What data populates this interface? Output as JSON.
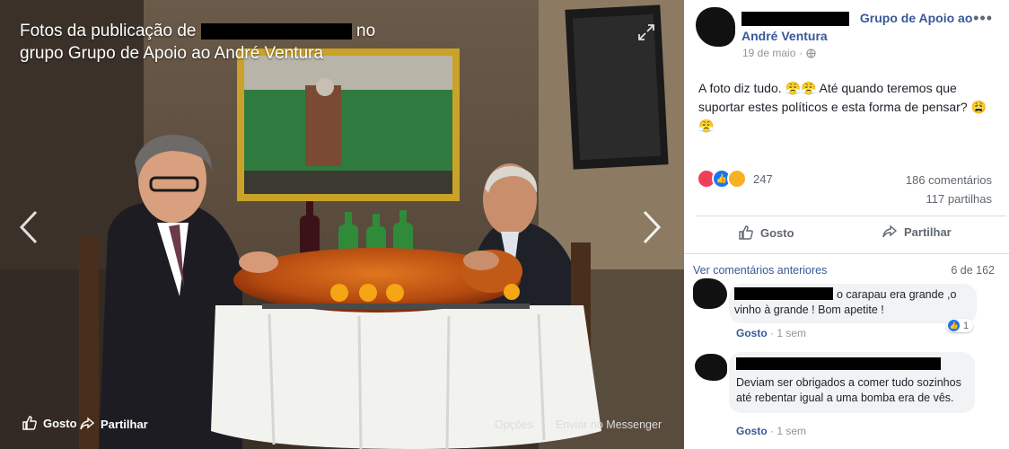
{
  "viewer": {
    "caption_line1_prefix": "Fotos da publicação de",
    "caption_line1_suffix": "no",
    "caption_line2": "grupo Grupo de Apoio ao André Ventura",
    "like_label": "Gosto",
    "share_label": "Partilhar",
    "options_label": "Opções",
    "messenger_label": "Enviar no Messenger"
  },
  "post": {
    "group_name": "Grupo de Apoio ao André Ventura",
    "date": "19 de maio",
    "text": "A foto diz tudo. 😤😤 Até quando teremos que suportar estes políticos e esta forma de pensar? 😩😤",
    "reaction_count": "247",
    "comments_count": "186 comentários",
    "shares_count": "117 partilhas",
    "like_button": "Gosto",
    "share_button": "Partilhar"
  },
  "comments": {
    "view_previous": "Ver comentários anteriores",
    "counter": "6 de 162",
    "items": [
      {
        "text": "o carapau era grande ,o vinho à grande ! Bom apetite !",
        "like_label": "Gosto",
        "time": "1 sem",
        "likes": "1"
      },
      {
        "text": "Deviam ser obrigados a comer tudo sozinhos até rebentar igual a uma bomba era de vês.",
        "like_label": "Gosto",
        "time": "1 sem"
      }
    ]
  },
  "colors": {
    "link_blue": "#385898",
    "muted_gray": "#606770",
    "viewer_bg": "#3a3026"
  }
}
